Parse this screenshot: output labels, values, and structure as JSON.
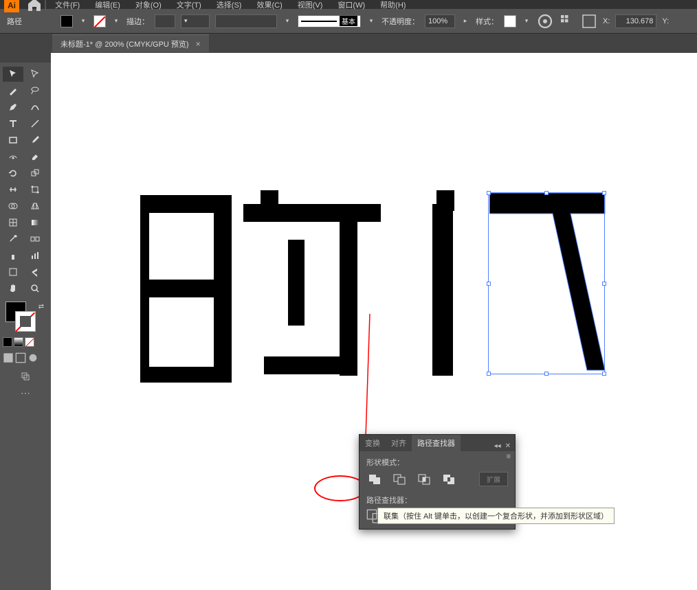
{
  "app": {
    "logo": "Ai"
  },
  "menu": {
    "items": [
      "文件(F)",
      "编辑(E)",
      "对象(O)",
      "文字(T)",
      "选择(S)",
      "效果(C)",
      "视图(V)",
      "窗口(W)",
      "帮助(H)"
    ]
  },
  "controlbar": {
    "selection_label": "路径",
    "stroke_label": "描边：",
    "stroke_weight": "",
    "stroke_style_label": "基本",
    "opacity_label": "不透明度：",
    "opacity_value": "100%",
    "style_label": "样式：",
    "x_label": "X:",
    "x_value": "130.678",
    "y_label": "Y:"
  },
  "document": {
    "tab_title": "未标题-1* @ 200% (CMYK/GPU 预览)"
  },
  "pathfinder": {
    "tabs": [
      "变换",
      "对齐",
      "路径查找器"
    ],
    "active_tab": 2,
    "shape_modes_label": "形状模式：",
    "expand_label": "扩展",
    "pathfinders_label": "路径查找器："
  },
  "tooltip": {
    "text": "联集（按住 Alt 键单击，以创建一个复合形状，并添加到形状区域）"
  },
  "tools": {
    "left_col": [
      "selection",
      "magic-wand",
      "pen",
      "type",
      "line",
      "rect",
      "shaper",
      "rotate",
      "width",
      "free-transform",
      "shape-builder",
      "mesh",
      "eyedropper",
      "symbol",
      "column-graph",
      "artboard",
      "slice",
      "hand"
    ],
    "right_col": [
      "direct-selection",
      "lasso",
      "curvature",
      "touch-type",
      "paintbrush",
      "eraser",
      "scissors",
      "scale",
      "warp",
      "puppet",
      "live-paint",
      "gradient",
      "measure",
      "spray",
      "area-graph",
      "slice-select",
      "print-tiling",
      "zoom"
    ]
  }
}
